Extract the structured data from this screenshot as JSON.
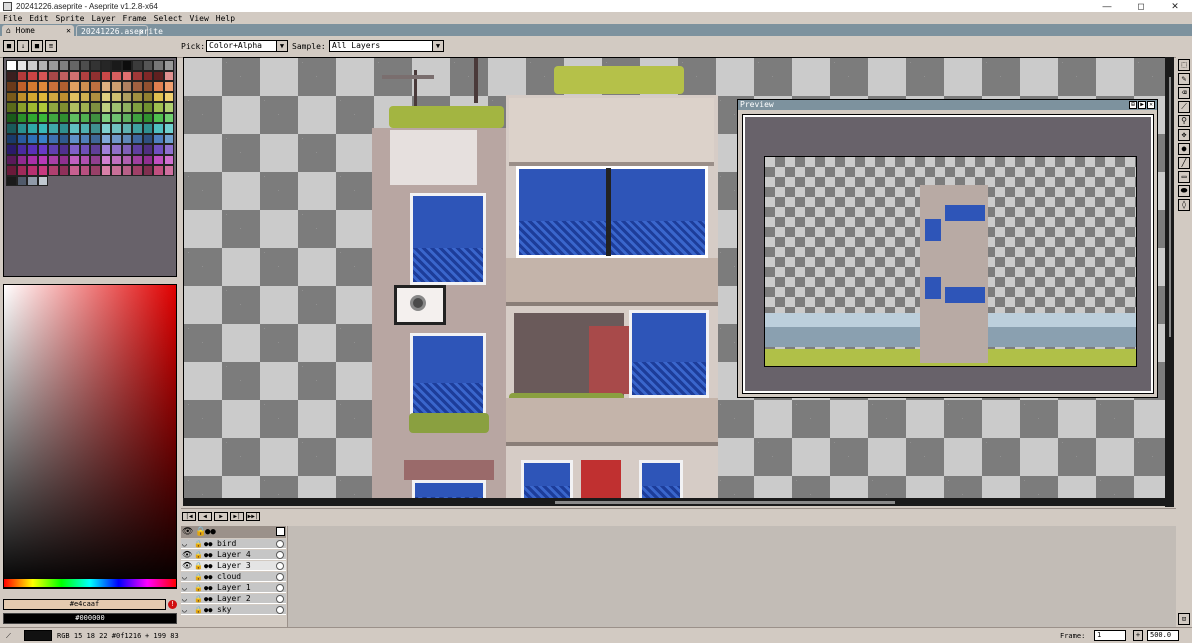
{
  "window": {
    "title": "20241226.aseprite - Aseprite v1.2.8-x64",
    "controls": [
      "—",
      "◻",
      "✕"
    ]
  },
  "menu": [
    "File",
    "Edit",
    "Sprite",
    "Layer",
    "Frame",
    "Select",
    "View",
    "Help"
  ],
  "tabs": [
    {
      "label": "Home",
      "close": "✕"
    },
    {
      "label": "20241226.aseprite",
      "close": "✕"
    }
  ],
  "context": {
    "pick_label": "Pick:",
    "pick_value": "Color+Alpha",
    "sample_label": "Sample:",
    "sample_value": "All Layers"
  },
  "colors": {
    "foreground_hex": "#e4caaf",
    "background_hex": "#000000",
    "ui_bg": "#d2cac2",
    "accent": "#7d929e"
  },
  "palette": [
    "#ffffff",
    "#e6e6e6",
    "#cccccc",
    "#b3b3b3",
    "#999999",
    "#808080",
    "#666666",
    "#4d4d4d",
    "#333333",
    "#262626",
    "#1a1a1a",
    "#0d0d0d",
    "#3b3b3b",
    "#555555",
    "#777777",
    "#999999",
    "#3a1f1f",
    "#b33a3a",
    "#cc4444",
    "#d65555",
    "#a84848",
    "#c06060",
    "#d07070",
    "#b04040",
    "#903030",
    "#c84848",
    "#d86060",
    "#e07070",
    "#a03838",
    "#802828",
    "#602020",
    "#e09090",
    "#6a3a1a",
    "#c0602a",
    "#d47a30",
    "#e08a3a",
    "#c8703a",
    "#b06030",
    "#e0a060",
    "#d09050",
    "#c07040",
    "#e0b080",
    "#d0a070",
    "#b08060",
    "#a06040",
    "#905030",
    "#e08050",
    "#f0a070",
    "#7a5a1a",
    "#c0902a",
    "#d4a830",
    "#e0b83a",
    "#d0a840",
    "#c09030",
    "#e0c060",
    "#d0b050",
    "#b09040",
    "#e0d080",
    "#d0c070",
    "#b0a060",
    "#a09040",
    "#908030",
    "#e0c050",
    "#f0d070",
    "#5a6a1a",
    "#8aa02a",
    "#a0b830",
    "#b0c83a",
    "#90a840",
    "#809030",
    "#b0c060",
    "#a0b050",
    "#809040",
    "#c0d080",
    "#a0c070",
    "#90b060",
    "#80a040",
    "#709030",
    "#a0c050",
    "#b0d070",
    "#1a5a1a",
    "#2a902a",
    "#30a830",
    "#3ab83a",
    "#40a840",
    "#309030",
    "#60c060",
    "#50b050",
    "#409040",
    "#80d080",
    "#70c070",
    "#60b060",
    "#40a040",
    "#309030",
    "#50c050",
    "#70d070",
    "#1a5a5a",
    "#2a9090",
    "#30a8a8",
    "#3ab8b8",
    "#40a8a8",
    "#309090",
    "#60c0c0",
    "#50b0b0",
    "#409090",
    "#80d0d0",
    "#70c0c0",
    "#60b0b0",
    "#40a0a0",
    "#309090",
    "#50c0c0",
    "#70d0d0",
    "#1a3a6a",
    "#2a5aa0",
    "#3070b8",
    "#3a80c8",
    "#4070b0",
    "#305a90",
    "#6090c8",
    "#5080b8",
    "#406898",
    "#80a8d8",
    "#7098c8",
    "#6088b8",
    "#4068a0",
    "#305080",
    "#5080c0",
    "#70a0d0",
    "#2a1a6a",
    "#4a2aa0",
    "#5a30b8",
    "#6a3ac8",
    "#6040b0",
    "#503090",
    "#8060c8",
    "#7050b8",
    "#604098",
    "#a080d8",
    "#9070c8",
    "#8060b8",
    "#6040a0",
    "#503080",
    "#7050c0",
    "#9070d0",
    "#5a1a5a",
    "#902a90",
    "#a830a8",
    "#b83ab8",
    "#a840a8",
    "#903090",
    "#c060c0",
    "#b050b0",
    "#904090",
    "#d080d0",
    "#c070c0",
    "#b060b0",
    "#a040a0",
    "#903090",
    "#c050c0",
    "#d070d0",
    "#6a1a3a",
    "#a02a5a",
    "#b83070",
    "#c83a80",
    "#b04070",
    "#90305a",
    "#c86090",
    "#b85080",
    "#984068",
    "#d880a8",
    "#c87098",
    "#b86088",
    "#a04068",
    "#803050",
    "#c05080",
    "#d070a0",
    "#1a1a1a",
    "#505a6a",
    "#909aa8",
    "#c0c8d0"
  ],
  "preview": {
    "title": "Preview",
    "buttons": [
      "⊞",
      "▶",
      "✕"
    ]
  },
  "timeline": {
    "controls": [
      "|◀",
      "◀",
      "▶",
      "▶|",
      "▶▶|"
    ],
    "layers": [
      {
        "name": "bird",
        "visible": false
      },
      {
        "name": "Layer 4",
        "visible": true
      },
      {
        "name": "Layer 3",
        "visible": true
      },
      {
        "name": "cloud",
        "visible": false
      },
      {
        "name": "Layer 1",
        "visible": false
      },
      {
        "name": "Layer 2",
        "visible": false
      },
      {
        "name": "sky",
        "visible": false
      }
    ]
  },
  "status": {
    "readout": "RGB 15 18 22 #0f1216",
    "position": "+ 199 83",
    "frame_label": "Frame:",
    "frame_value": "1",
    "zoom_value": "500.0"
  }
}
